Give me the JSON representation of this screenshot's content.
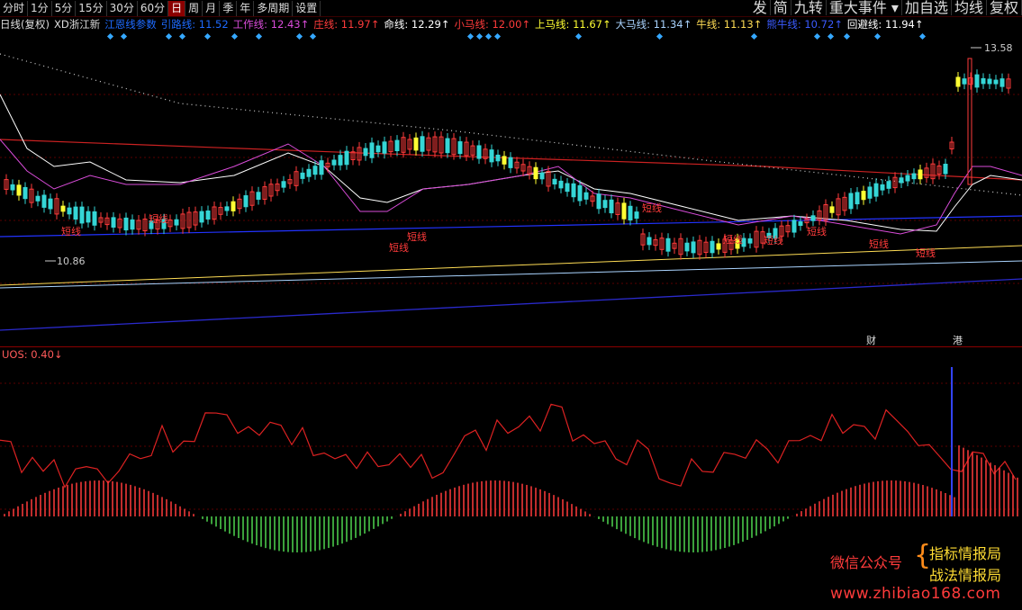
{
  "toolbar": {
    "left": [
      "分时",
      "1分",
      "5分",
      "15分",
      "30分",
      "60分",
      "日",
      "周",
      "月",
      "季",
      "年",
      "多周期",
      "设置"
    ],
    "active": "日",
    "right": [
      "发",
      "简",
      "九转",
      "重大事件",
      "加自选",
      "均线",
      "复权"
    ]
  },
  "legend": {
    "period": "日线(复权)",
    "name": "XD浙江新",
    "items": [
      {
        "label": "江恩线参数",
        "value": "",
        "color": "#1e6bff"
      },
      {
        "label": "引路线:",
        "value": "11.52",
        "color": "#1e6bff"
      },
      {
        "label": "工作线:",
        "value": "12.43↑",
        "color": "#d94cd9"
      },
      {
        "label": "庄线:",
        "value": "11.97↑",
        "color": "#ff3b3b"
      },
      {
        "label": "命线:",
        "value": "12.29↑",
        "color": "#ffffff"
      },
      {
        "label": "小马线:",
        "value": "12.00↑",
        "color": "#ff3b3b"
      },
      {
        "label": "上马线:",
        "value": "11.67↑",
        "color": "#ffff33"
      },
      {
        "label": "大马线:",
        "value": "11.34↑",
        "color": "#aad4ff"
      },
      {
        "label": "牛线:",
        "value": "11.13↑",
        "color": "#ffdd55"
      },
      {
        "label": "熊牛线:",
        "value": "10.72↑",
        "color": "#3b5bff"
      },
      {
        "label": "回避线:",
        "value": "11.94↑",
        "color": "#ffffff"
      }
    ]
  },
  "price_chart": {
    "high_label": "13.58",
    "low_label": "10.86",
    "signal_text": "短线",
    "event_labels": [
      "财",
      "港"
    ]
  },
  "indicator": {
    "label": "UOS: 0.40↓"
  },
  "watermark": {
    "line1": "微信公众号",
    "line2a": "指标情报局",
    "line2b": "战法情报局",
    "url": "www.zhibiao168.com"
  },
  "colors": {
    "up": "#ff3b3b",
    "down": "#35d6d6",
    "bg": "#000000",
    "grid": "#5a0000"
  }
}
